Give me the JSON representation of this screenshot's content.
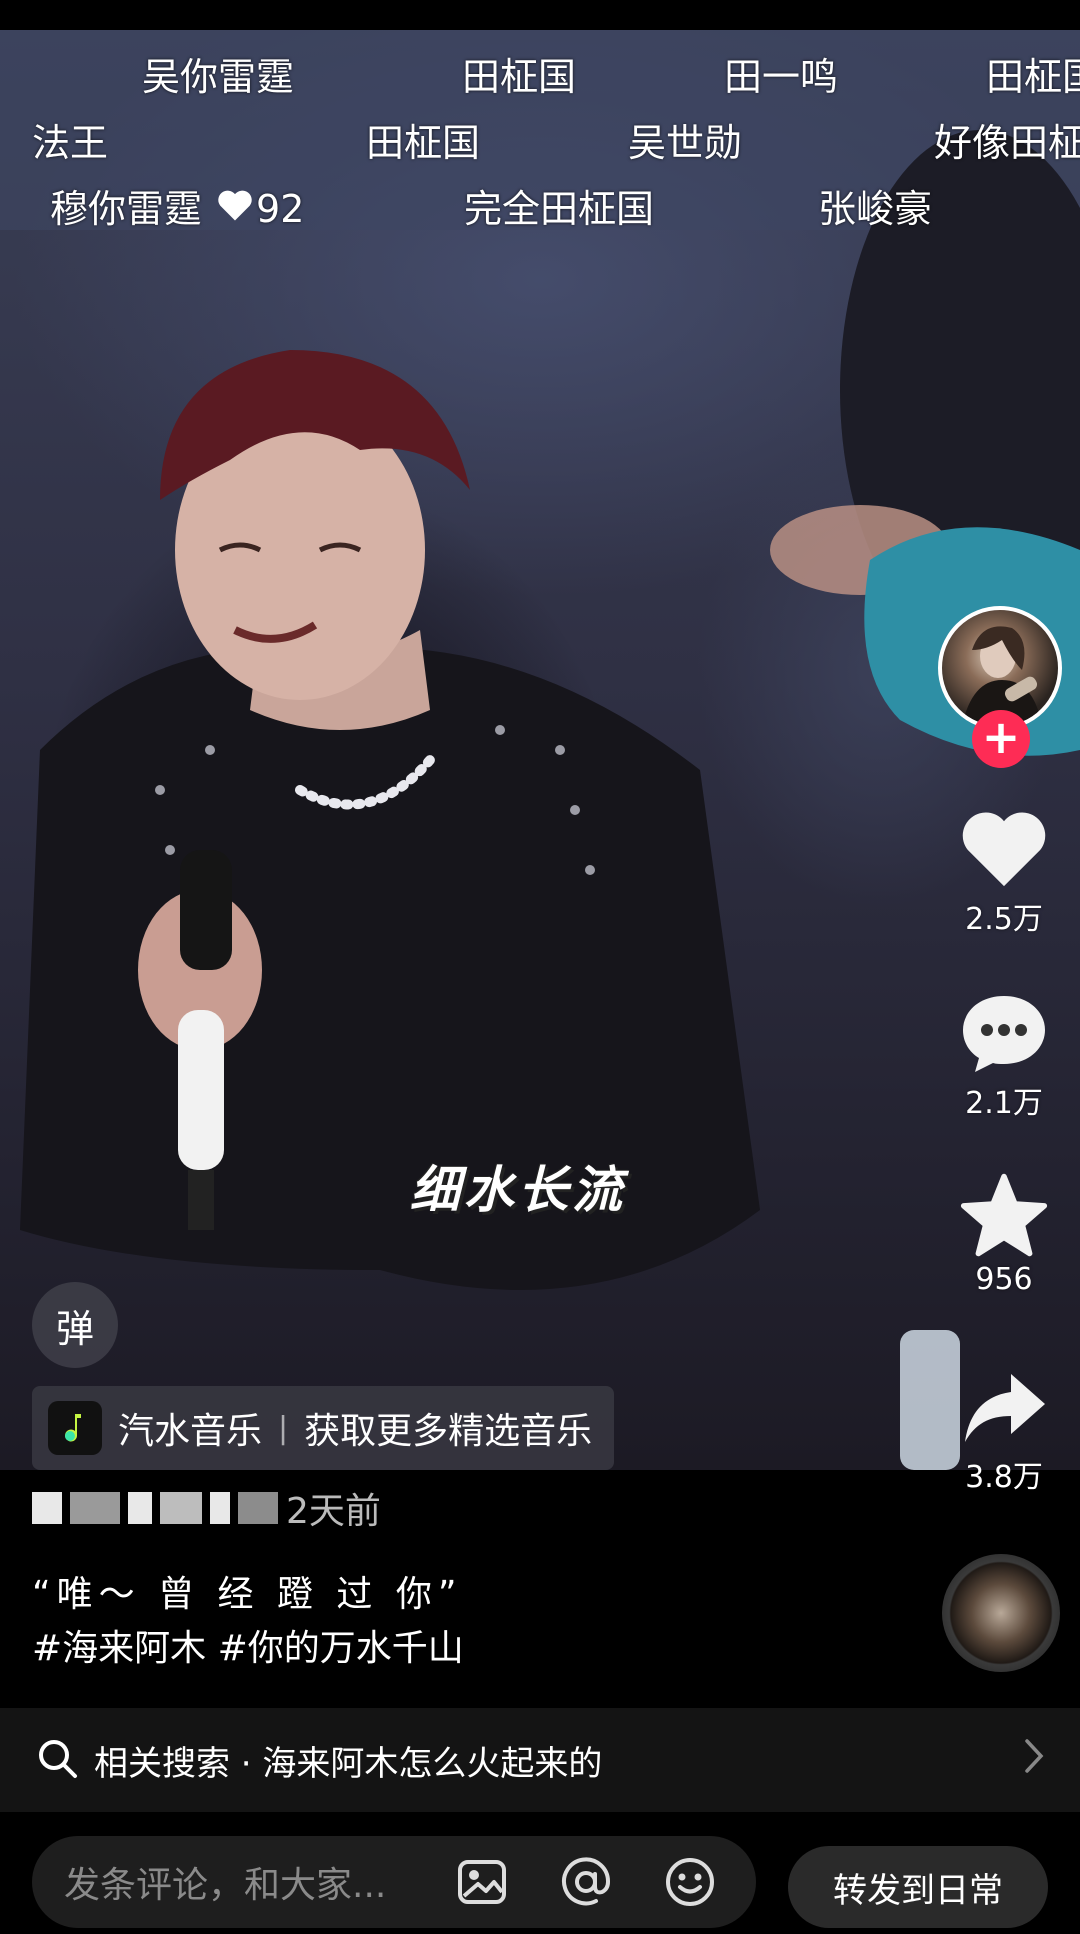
{
  "danmaku": [
    {
      "text": "吴你雷霆"
    },
    {
      "text": "田柾国"
    },
    {
      "text": "田一鸣"
    },
    {
      "text": "田柾国"
    },
    {
      "text": "法王"
    },
    {
      "text": "田柾国"
    },
    {
      "text": "吴世勋"
    },
    {
      "text": "好像田柾"
    },
    {
      "text": "穆你雷霆",
      "likes": "92"
    },
    {
      "text": "完全田柾国"
    },
    {
      "text": "张峻豪"
    }
  ],
  "video": {
    "subtitle": "细水长流"
  },
  "danmaku_toggle_label": "弹",
  "music_bar": {
    "app_name": "汽水音乐",
    "separator": "|",
    "promo": "获取更多精选音乐"
  },
  "actions": {
    "likes": "2.5万",
    "comments": "2.1万",
    "favorites": "956",
    "shares": "3.8万"
  },
  "post": {
    "time_suffix": "2天前",
    "caption_line1": "“唯～ 曾 经 蹬 过 你”",
    "caption_line2": "#海来阿木 #你的万水千山"
  },
  "related_search": {
    "text": "相关搜索 · 海来阿木怎么火起来的"
  },
  "comment": {
    "placeholder": "发条评论，和大家...",
    "share_label": "转发到日常"
  },
  "colors": {
    "follow_red": "#fe2c55",
    "background": "#000000"
  }
}
